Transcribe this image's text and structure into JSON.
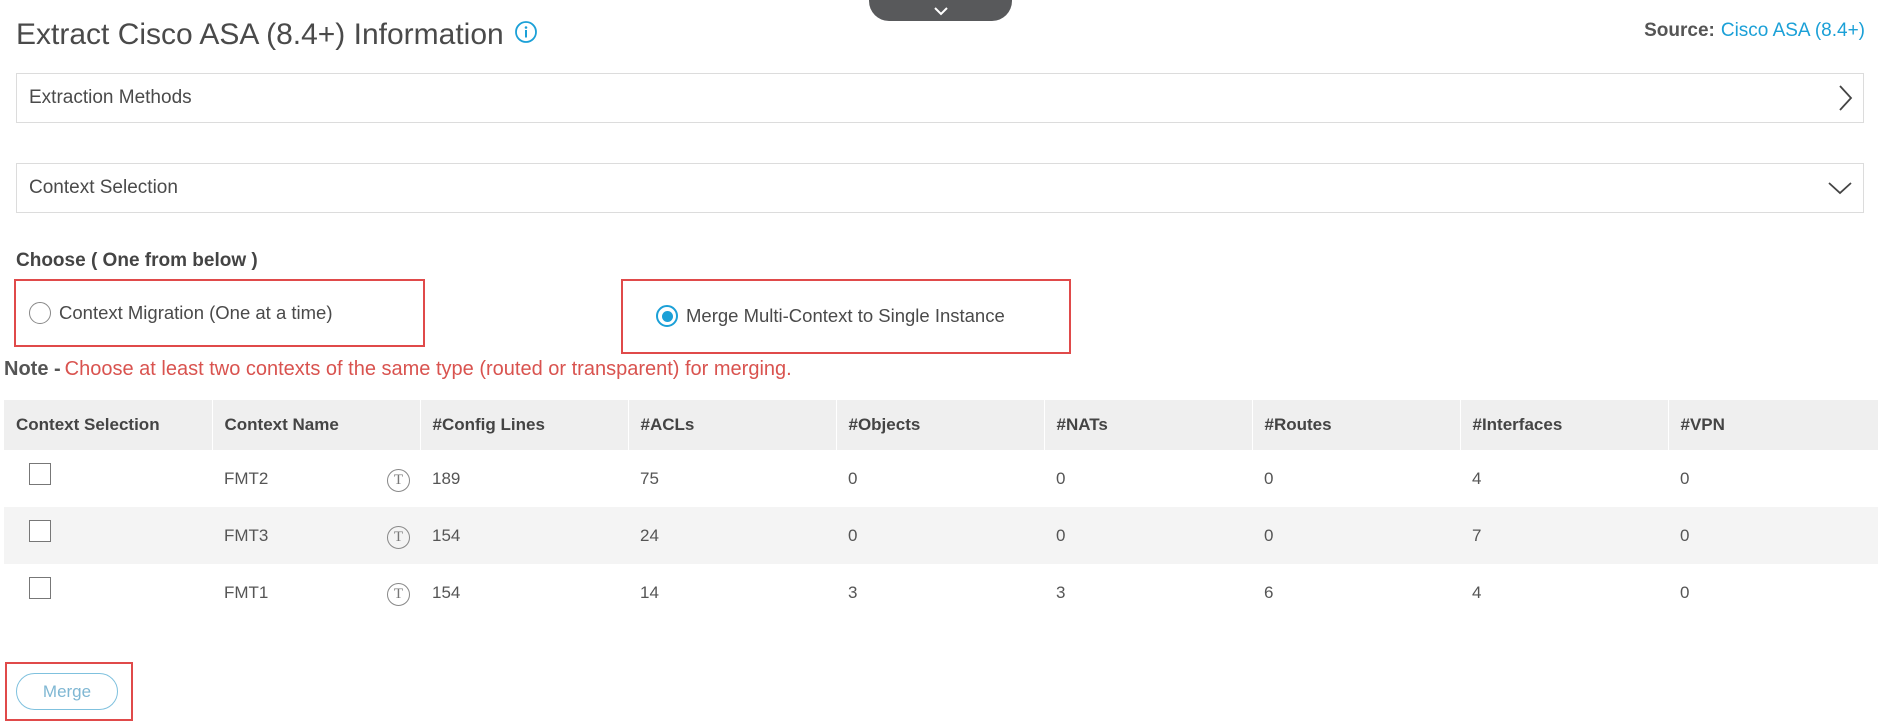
{
  "header": {
    "title": "Extract Cisco ASA (8.4+) Information",
    "source_label": "Source:",
    "source_value": "Cisco ASA (8.4+)"
  },
  "panels": {
    "extraction_methods": "Extraction Methods",
    "context_selection": "Context Selection"
  },
  "choose": {
    "heading": "Choose ( One from below )",
    "options": [
      {
        "label": "Context Migration (One at a time)",
        "selected": false
      },
      {
        "label": "Merge Multi-Context to Single Instance",
        "selected": true
      }
    ]
  },
  "note": {
    "label": "Note -",
    "text": "Choose at least two contexts of the same type (routed or transparent) for merging."
  },
  "table": {
    "headers": [
      "Context Selection",
      "Context Name",
      "#Config Lines",
      "#ACLs",
      "#Objects",
      "#NATs",
      "#Routes",
      "#Interfaces",
      "#VPN"
    ],
    "rows": [
      {
        "checked": false,
        "name": "FMT2",
        "type_icon": "T",
        "config_lines": "189",
        "acls": "75",
        "objects": "0",
        "nats": "0",
        "routes": "0",
        "interfaces": "4",
        "vpn": "0"
      },
      {
        "checked": false,
        "name": "FMT3",
        "type_icon": "T",
        "config_lines": "154",
        "acls": "24",
        "objects": "0",
        "nats": "0",
        "routes": "0",
        "interfaces": "7",
        "vpn": "0"
      },
      {
        "checked": false,
        "name": "FMT1",
        "type_icon": "T",
        "config_lines": "154",
        "acls": "14",
        "objects": "3",
        "nats": "3",
        "routes": "6",
        "interfaces": "4",
        "vpn": "0"
      }
    ]
  },
  "actions": {
    "merge_label": "Merge"
  },
  "colors": {
    "accent": "#1ba0d7",
    "note_red": "#d9534f",
    "highlight_red": "#e04a4a"
  }
}
